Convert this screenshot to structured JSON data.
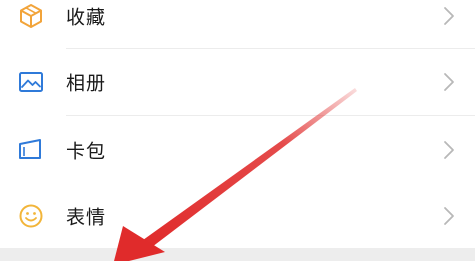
{
  "menu": {
    "items": [
      {
        "label": "收藏",
        "icon": "favorites-cube-icon",
        "icon_color": "#f2a43a"
      },
      {
        "label": "相册",
        "icon": "album-picture-icon",
        "icon_color": "#2f7ad9"
      },
      {
        "label": "卡包",
        "icon": "card-wallet-icon",
        "icon_color": "#2f7ad9"
      },
      {
        "label": "表情",
        "icon": "sticker-smiley-icon",
        "icon_color": "#f2b53a"
      }
    ]
  },
  "colors": {
    "background": "#ffffff",
    "text": "#1a1a1a",
    "chevron": "#b8b8b8",
    "divider": "#ececec",
    "section_gap": "#ededed",
    "annotation_arrow": "#e02b2b"
  },
  "annotation": {
    "icon": "red-pointer-arrow-icon"
  }
}
